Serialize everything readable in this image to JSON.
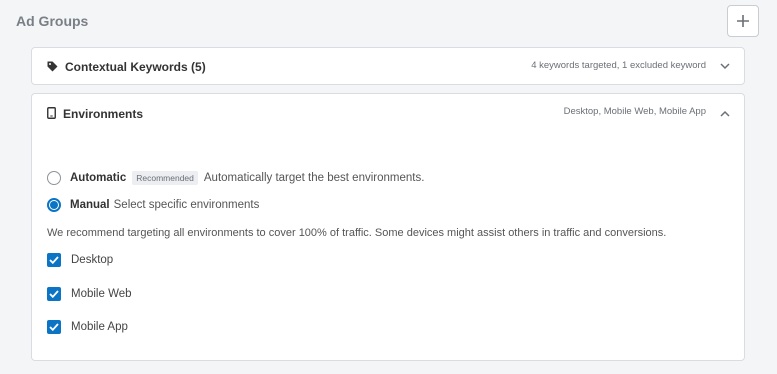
{
  "title": "Ad Groups",
  "add_button": {
    "label": "+"
  },
  "keywords_card": {
    "label": "Contextual Keywords (5)",
    "summary": "4 keywords targeted, 1 excluded keyword",
    "icon": "tag-icon",
    "expanded": false
  },
  "environments_card": {
    "label": "Environments",
    "summary": "Desktop, Mobile Web, Mobile App",
    "icon": "tablet-icon",
    "expanded": true,
    "options": [
      {
        "label": "Automatic",
        "badge": "Recommended",
        "description": "Automatically target the best environments.",
        "selected": false
      },
      {
        "label": "Manual",
        "description": "Select specific environments",
        "selected": true
      }
    ],
    "note": "We recommend targeting all environments to cover 100% of traffic. Some devices might assist others in traffic and conversions.",
    "checkboxes": [
      {
        "label": "Desktop",
        "checked": true
      },
      {
        "label": "Mobile Web",
        "checked": true
      },
      {
        "label": "Mobile App",
        "checked": true
      }
    ]
  },
  "colors": {
    "accent": "#0b74c4",
    "border": "#d9dce1",
    "background": "#f4f5f7"
  }
}
